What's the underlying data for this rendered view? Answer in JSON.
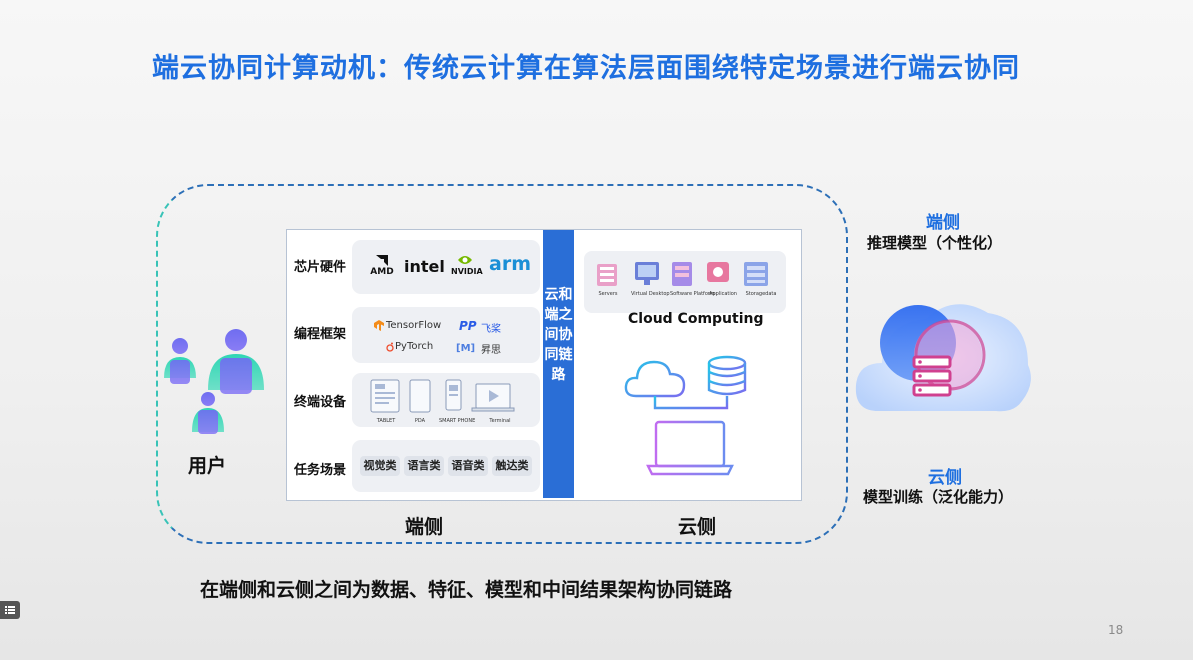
{
  "slide": {
    "title": "端云协同计算动机：传统云计算在算法层面围绕特定场景进行端云协同",
    "page_number": "18"
  },
  "user": {
    "label": "用户"
  },
  "rows": [
    {
      "label": "芯片硬件"
    },
    {
      "label": "编程框架"
    },
    {
      "label": "终端设备"
    },
    {
      "label": "任务场景"
    }
  ],
  "chips": {
    "amd": "AMD",
    "intel": "intel",
    "nvidia": "NVIDIA",
    "arm": "arm"
  },
  "frameworks": {
    "tensorflow": "TensorFlow",
    "paddle": "飞桨",
    "pytorch": "PyTorch",
    "mindspore": "昇思"
  },
  "devices": [
    "TABLET",
    "PDA",
    "SMART PHONE",
    "Terminal"
  ],
  "tasks": [
    "视觉类",
    "语言类",
    "语音类",
    "触达类"
  ],
  "link_bar": {
    "text": "云和端之间协同链路"
  },
  "cloud": {
    "label": "Cloud Computing",
    "icons": [
      "Servers",
      "Virtual Desktop",
      "Software Platform",
      "Application",
      "Storagedata"
    ]
  },
  "bottom_labels": {
    "device_side": "端侧",
    "cloud_side": "云侧"
  },
  "right": {
    "device_title": "端侧",
    "device_desc": "推理模型（个性化）",
    "cloud_title": "云侧",
    "cloud_desc": "模型训练（泛化能力）"
  },
  "footer": {
    "text": "在端侧和云侧之间为数据、特征、模型和中间结果架构协同链路"
  },
  "menu_icon": "list-icon",
  "colors": {
    "accent": "#1e6fe0",
    "link_bar": "#2a6ed6",
    "arm": "#1a8fd6"
  }
}
